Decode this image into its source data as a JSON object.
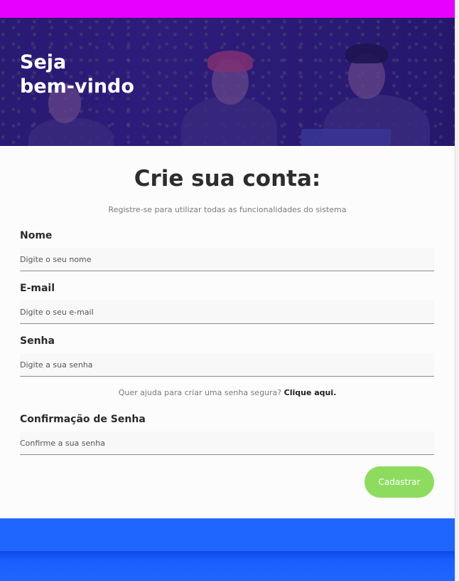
{
  "colors": {
    "top_bar": "#e600ff",
    "hero_overlay": "#2a1f6e",
    "submit_button": "#8ddc5f",
    "footer": "#1f66ff"
  },
  "hero": {
    "title_line1": "Seja",
    "title_line2": "bem-vindo"
  },
  "form": {
    "title": "Crie sua conta:",
    "subtitle": "Registre-se para utilizar todas as funcionalidades do sistema",
    "fields": [
      {
        "label": "Nome",
        "placeholder": "Digite o seu nome",
        "value": ""
      },
      {
        "label": "E-mail",
        "placeholder": "Digite o seu e-mail",
        "value": ""
      },
      {
        "label": "Senha",
        "placeholder": "Digite a sua senha",
        "value": ""
      },
      {
        "label": "Confirmação de Senha",
        "placeholder": "Confirme a sua senha",
        "value": ""
      }
    ],
    "password_help_text": "Quer ajuda para criar uma senha segura?",
    "password_help_link": "Clique aqui.",
    "submit_label": "Cadastrar"
  }
}
